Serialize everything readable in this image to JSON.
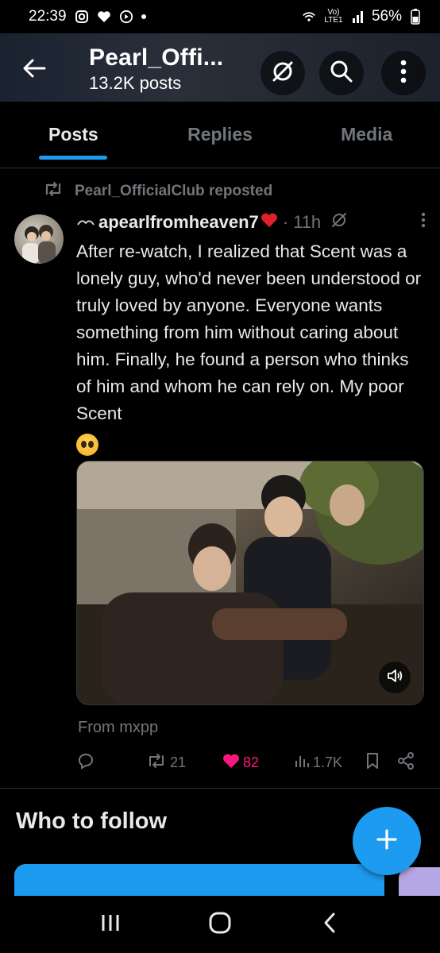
{
  "status_bar": {
    "time": "22:39",
    "battery": "56%",
    "network": "Vo) LTE1",
    "icons": [
      "instagram-icon",
      "heart-icon",
      "youtube-icon",
      "wifi-icon",
      "signal-icon",
      "battery-icon"
    ]
  },
  "header": {
    "title": "Pearl_Offi...",
    "subtitle": "13.2K posts",
    "icons": [
      "back-arrow-icon",
      "grok-icon",
      "search-icon",
      "more-vertical-icon"
    ]
  },
  "tabs": [
    {
      "label": "Posts",
      "active": true
    },
    {
      "label": "Replies",
      "active": false
    },
    {
      "label": "Media",
      "active": false
    }
  ],
  "post": {
    "repost_text": "Pearl_OfficialClub reposted",
    "author": "apearlfromheaven7",
    "time": "11h",
    "separator": "·",
    "text": "After re-watch, I realized that Scent was a lonely guy, who'd never been understood or truly loved by anyone. Everyone wants something from him without caring about him. Finally, he found a person who thinks of him and whom he can rely on. My poor Scent",
    "source": "From mxpp",
    "stats": {
      "replies": "",
      "reposts": "21",
      "likes": "82",
      "views": "1.7K"
    }
  },
  "who_to_follow": {
    "title": "Who to follow"
  },
  "colors": {
    "accent": "#1d9bf0",
    "like": "#f91880",
    "muted": "#71767b",
    "text": "#e7e9ea"
  }
}
